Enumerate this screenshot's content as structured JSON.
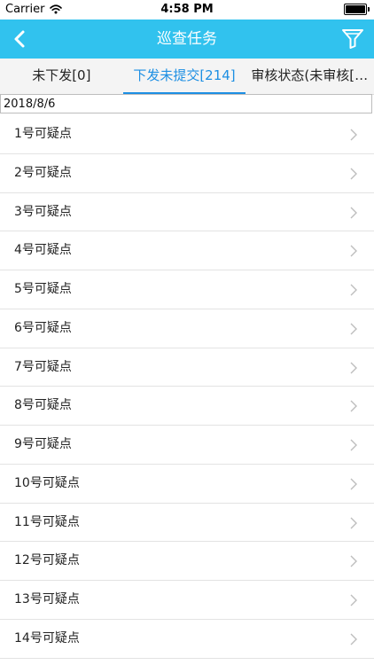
{
  "status_bar": {
    "carrier": "Carrier",
    "time": "4:58 PM"
  },
  "navbar": {
    "title": "巡查任务"
  },
  "tabs": [
    {
      "label": "未下发[0]"
    },
    {
      "label": "下发未提交[214]"
    },
    {
      "label": "审核状态(未审核[0..."
    }
  ],
  "date_field": {
    "value": "2018/8/6"
  },
  "list": [
    {
      "label": "1号可疑点"
    },
    {
      "label": "2号可疑点"
    },
    {
      "label": "3号可疑点"
    },
    {
      "label": "4号可疑点"
    },
    {
      "label": "5号可疑点"
    },
    {
      "label": "6号可疑点"
    },
    {
      "label": "7号可疑点"
    },
    {
      "label": "8号可疑点"
    },
    {
      "label": "9号可疑点"
    },
    {
      "label": "10号可疑点"
    },
    {
      "label": "11号可疑点"
    },
    {
      "label": "12号可疑点"
    },
    {
      "label": "13号可疑点"
    },
    {
      "label": "14号可疑点"
    }
  ],
  "colors": {
    "navbar": "#31c2ee",
    "active_tab": "#1d8fe3"
  }
}
